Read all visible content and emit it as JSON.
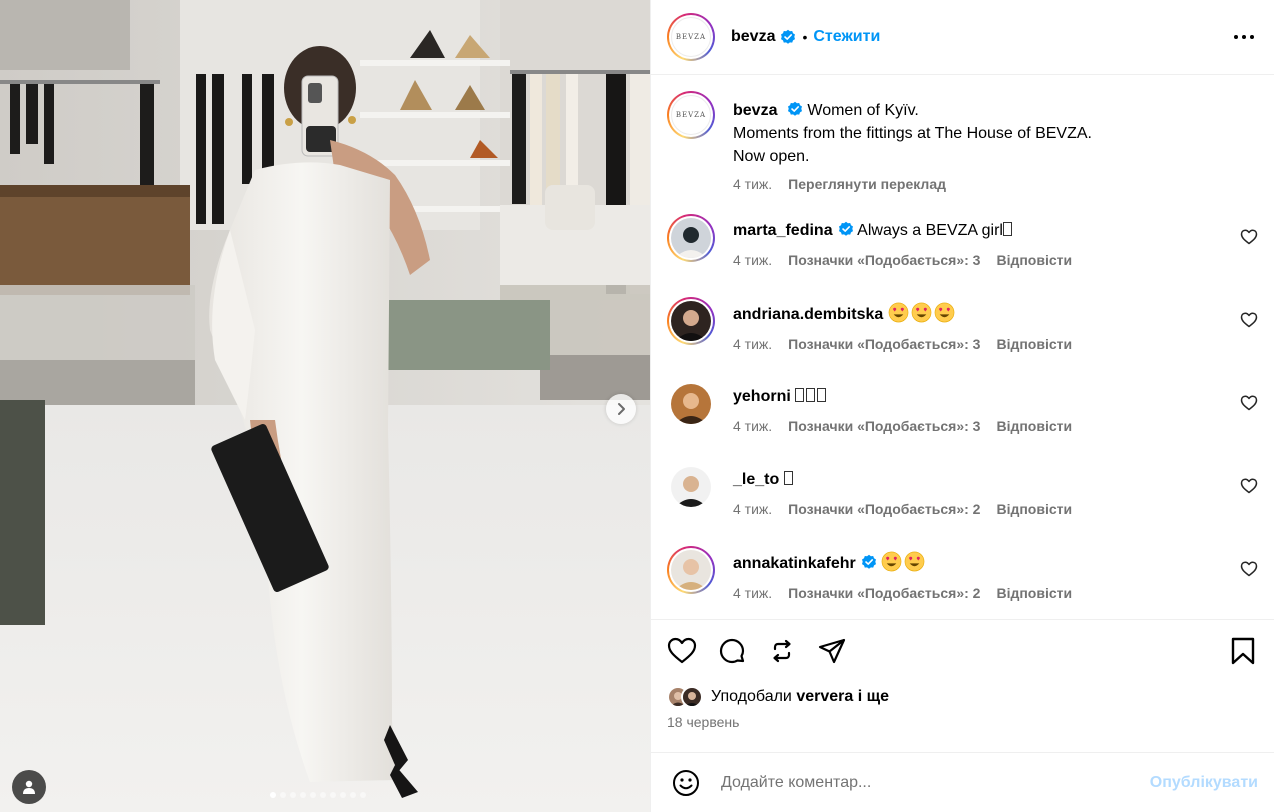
{
  "post_media": {
    "next_label": "›",
    "dots_total": 10,
    "dots_active": 0
  },
  "header": {
    "username": "bevza",
    "separator": "•",
    "follow_label": "Стежити",
    "logo_text": "BEVZA"
  },
  "caption": {
    "username": "bevza",
    "lines": [
      "Women of Kyïv.",
      "Moments from the fittings at The House of BEVZA.",
      "Now open."
    ],
    "time": "4 тиж.",
    "translate_label": "Переглянути переклад"
  },
  "comments": [
    {
      "username": "marta_fedina",
      "verified": true,
      "text": "Always a BEVZA girl",
      "emoji": [
        "tofu"
      ],
      "time": "4 тиж.",
      "likes_label": "Позначки «Подобається»: 3",
      "reply_label": "Відповісти",
      "ring": true
    },
    {
      "username": "andriana.dembitska",
      "verified": false,
      "text": "",
      "emoji": [
        "heart-eyes",
        "heart-eyes",
        "heart-eyes"
      ],
      "time": "4 тиж.",
      "likes_label": "Позначки «Подобається»: 3",
      "reply_label": "Відповісти",
      "ring": true
    },
    {
      "username": "yehorni",
      "verified": false,
      "text": "",
      "emoji": [
        "tofu",
        "tofu",
        "tofu"
      ],
      "time": "4 тиж.",
      "likes_label": "Позначки «Подобається»: 3",
      "reply_label": "Відповісти",
      "ring": false
    },
    {
      "username": "_le_to",
      "verified": false,
      "text": "",
      "emoji": [
        "tofu"
      ],
      "time": "4 тиж.",
      "likes_label": "Позначки «Подобається»: 2",
      "reply_label": "Відповісти",
      "ring": false
    },
    {
      "username": "annakatinkafehr",
      "verified": true,
      "text": "",
      "emoji": [
        "heart-eyes",
        "heart-eyes"
      ],
      "time": "4 тиж.",
      "likes_label": "Позначки «Подобається»: 2",
      "reply_label": "Відповісти",
      "ring": true
    }
  ],
  "actions": {
    "liked_by_prefix": "Уподобали",
    "liked_by_user": "ververa",
    "liked_by_suffix": "і ще",
    "date": "18 червень"
  },
  "add_comment": {
    "placeholder": "Додайте коментар...",
    "publish_label": "Опублікувати"
  },
  "colors": {
    "link_blue": "#0095f6",
    "muted": "#737373",
    "publish_disabled": "#b3dbff",
    "verified_blue": "#0095f6"
  }
}
